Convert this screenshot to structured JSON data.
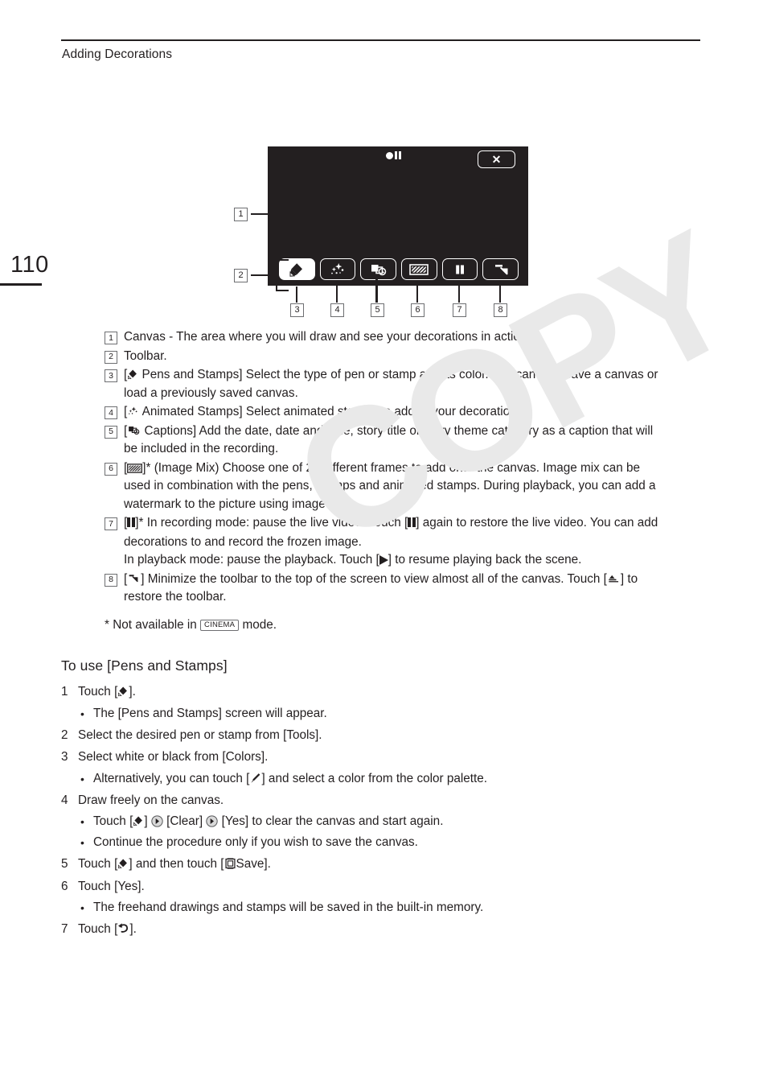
{
  "page": {
    "running_head": "Adding Decorations",
    "page_number": "110",
    "watermark": "COPY"
  },
  "figure": {
    "lcd": {
      "rec_indicator": "record-pause-indicator",
      "close_label": "✕",
      "toolbar_buttons": [
        {
          "name": "pens-and-stamps",
          "icon": "pen-icon",
          "active": true
        },
        {
          "name": "animated-stamps",
          "icon": "sparkle-icon",
          "active": false
        },
        {
          "name": "captions",
          "icon": "caption-clock-icon",
          "active": false
        },
        {
          "name": "image-mix",
          "icon": "image-mix-icon",
          "active": false
        },
        {
          "name": "pause",
          "icon": "pause-icon",
          "active": false
        },
        {
          "name": "minimize-toolbar",
          "icon": "minimize-arrow-icon",
          "active": false
        }
      ]
    },
    "callouts": [
      "1",
      "2",
      "3",
      "4",
      "5",
      "6",
      "7",
      "8"
    ]
  },
  "legend": [
    {
      "num": "1",
      "text": "Canvas - The area where you will draw and see your decorations in action."
    },
    {
      "num": "2",
      "text": "Toolbar."
    },
    {
      "num": "3",
      "icon": "pen-icon",
      "pre": "[",
      "text": "  Pens and Stamps] Select the type of pen or stamp and its color. You can also save a canvas or load a previously saved canvas."
    },
    {
      "num": "4",
      "icon": "sparkle-icon",
      "pre": "[",
      "text": "  Animated Stamps] Select animated stamps to add to your decoration."
    },
    {
      "num": "5",
      "icon": "caption-clock-icon",
      "pre": "[",
      "text": "  Captions] Add the date, date and time, story title or story theme category as a caption that will be included in the recording."
    },
    {
      "num": "6",
      "icon": "image-mix-icon",
      "pre": "[",
      "text": "]* (Image Mix) Choose one of 27 different frames to add onto the canvas. Image mix can be used in combination with the pens, stamps and animated stamps. During playback, you can add a watermark to the picture using image mix."
    },
    {
      "num": "7",
      "icon": "pause-icon",
      "line1_a": "]* In recording mode: pause the live video. Touch [",
      "line1_b": "] again to restore the live video. You can add decorations to and record the frozen image.",
      "line2_a": "In playback mode: pause the playback. Touch [",
      "line2_b": "] to resume playing back the scene."
    },
    {
      "num": "8",
      "icon": "minimize-arrow-icon",
      "text_a": "] Minimize the toolbar to the top of the screen to view almost all of the canvas. Touch [",
      "text_b": "] to restore the toolbar."
    }
  ],
  "footnote": {
    "prefix": "* Not available in",
    "badge": "CINEMA",
    "suffix": "mode."
  },
  "procedure": {
    "title": "To use [Pens and Stamps]",
    "steps": [
      {
        "num": "1",
        "text_a": "Touch [",
        "icon": "pen-icon",
        "text_b": "].",
        "subs": [
          {
            "bullet": "•",
            "text": "The [Pens and Stamps] screen will appear."
          }
        ]
      },
      {
        "num": "2",
        "text_a": "Select the desired pen or stamp from [Tools].",
        "subs": []
      },
      {
        "num": "3",
        "text_a": "Select white or black from [Colors].",
        "subs": [
          {
            "bullet": "•",
            "text_a": "Alternatively, you can touch [",
            "icon": "color-picker-pen-icon",
            "text_b": "] and select a color from the color palette."
          }
        ]
      },
      {
        "num": "4",
        "text_a": "Draw freely on the canvas.",
        "subs": [
          {
            "bullet": "•",
            "text_a": "Touch [",
            "icon": "pen-icon",
            "text_b": "] ",
            "arrow1": "arrow-circle-icon",
            "text_c": " [Clear] ",
            "arrow2": "arrow-circle-icon",
            "text_d": " [Yes] to clear the canvas and start again."
          },
          {
            "bullet": "•",
            "text": "Continue the procedure only if you wish to save the canvas."
          }
        ]
      },
      {
        "num": "5",
        "text_a": "Touch [",
        "icon": "pen-icon",
        "text_b": "] and then touch [",
        "icon2": "save-icon",
        "text_c": "Save].",
        "subs": []
      },
      {
        "num": "6",
        "text_a": "Touch [Yes].",
        "subs": [
          {
            "bullet": "•",
            "text": "The freehand drawings and stamps will be saved in the built-in memory."
          }
        ]
      },
      {
        "num": "7",
        "text_a": "Touch [",
        "icon": "return-arrow-icon",
        "text_b": "].",
        "subs": []
      }
    ]
  },
  "colors": {
    "ink": "#231f20",
    "rule": "#231f20",
    "callout_border": "#6d6e71",
    "watermark": "#e9e9e9",
    "lcd_background": "#231f20",
    "lcd_foreground": "#ffffff"
  }
}
